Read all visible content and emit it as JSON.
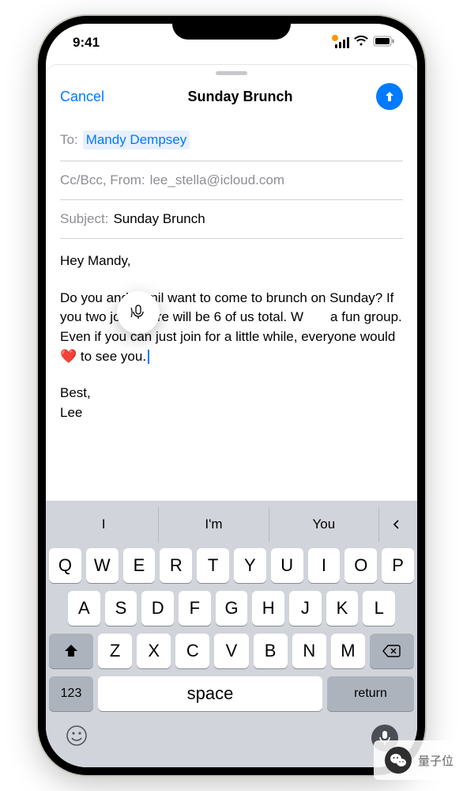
{
  "status": {
    "time": "9:41"
  },
  "nav": {
    "cancel": "Cancel",
    "title": "Sunday Brunch"
  },
  "compose": {
    "to_label": "To:",
    "to_recipient": "Mandy Dempsey",
    "ccbcc_label": "Cc/Bcc, From:",
    "from_value": "lee_stella@icloud.com",
    "subject_label": "Subject:",
    "subject_value": "Sunday Brunch",
    "body_greeting": "Hey Mandy,",
    "body_p1a": "Do you and Jamil want to come to brunch on Sunday? If you two join, there will be 6 of us total. W",
    "body_p1b": "a fun group. Even if you can just join for a little while, everyone would ",
    "body_heart": "❤️",
    "body_p1c": " to see you.",
    "body_signoff": "Best,",
    "body_name": "Lee"
  },
  "keyboard": {
    "predictions": [
      "I",
      "I'm",
      "You"
    ],
    "row1": [
      "Q",
      "W",
      "E",
      "R",
      "T",
      "Y",
      "U",
      "I",
      "O",
      "P"
    ],
    "row2": [
      "A",
      "S",
      "D",
      "F",
      "G",
      "H",
      "J",
      "K",
      "L"
    ],
    "row3": [
      "Z",
      "X",
      "C",
      "V",
      "B",
      "N",
      "M"
    ],
    "numkey": "123",
    "space": "space",
    "return": "return"
  },
  "badge": {
    "label": "量子位"
  }
}
